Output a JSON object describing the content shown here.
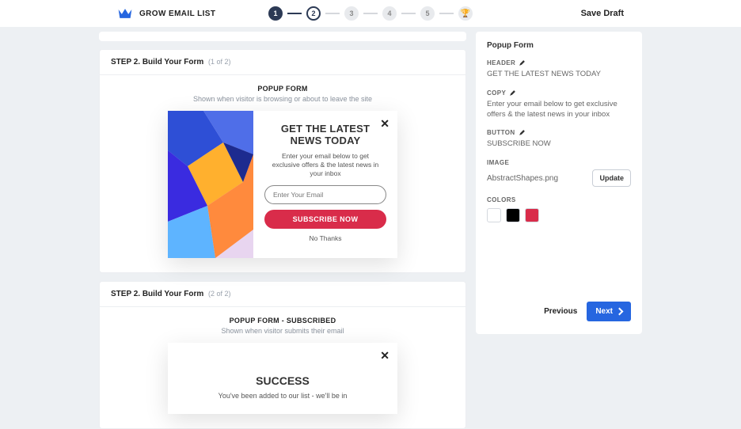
{
  "brand": {
    "title": "GROW EMAIL LIST"
  },
  "topbar": {
    "save_draft": "Save Draft",
    "steps": [
      "1",
      "2",
      "3",
      "4",
      "5"
    ]
  },
  "sections": {
    "step1": {
      "heading": "STEP 2. Build Your Form",
      "count": "(1 of 2)"
    },
    "form1": {
      "title": "POPUP FORM",
      "desc": "Shown when visitor is browsing or about to leave the site"
    },
    "step2": {
      "heading": "STEP 2. Build Your Form",
      "count": "(2 of 2)"
    },
    "form2": {
      "title": "POPUP FORM - SUBSCRIBED",
      "desc": "Shown when visitor submits their email"
    }
  },
  "preview": {
    "title": "GET THE LATEST NEWS TODAY",
    "copy": "Enter your email below to get exclusive offers & the latest news in your inbox",
    "placeholder": "Enter Your Email",
    "button": "SUBSCRIBE NOW",
    "nothanks": "No Thanks"
  },
  "success": {
    "title": "SUCCESS",
    "body": "You've been added to our list - we'll be in"
  },
  "panel": {
    "title": "Popup Form",
    "labels": {
      "header": "HEADER",
      "copy": "COPY",
      "button": "BUTTON",
      "image": "IMAGE",
      "colors": "COLORS"
    },
    "values": {
      "header": "GET THE LATEST NEWS TODAY",
      "copy": "Enter your email below to get exclusive offers & the latest news in your inbox",
      "button": "SUBSCRIBE NOW",
      "image": "AbstractShapes.png"
    },
    "update_label": "Update",
    "colors": [
      "#ffffff",
      "#000000",
      "#d92c4a"
    ]
  },
  "nav": {
    "previous": "Previous",
    "next": "Next"
  }
}
